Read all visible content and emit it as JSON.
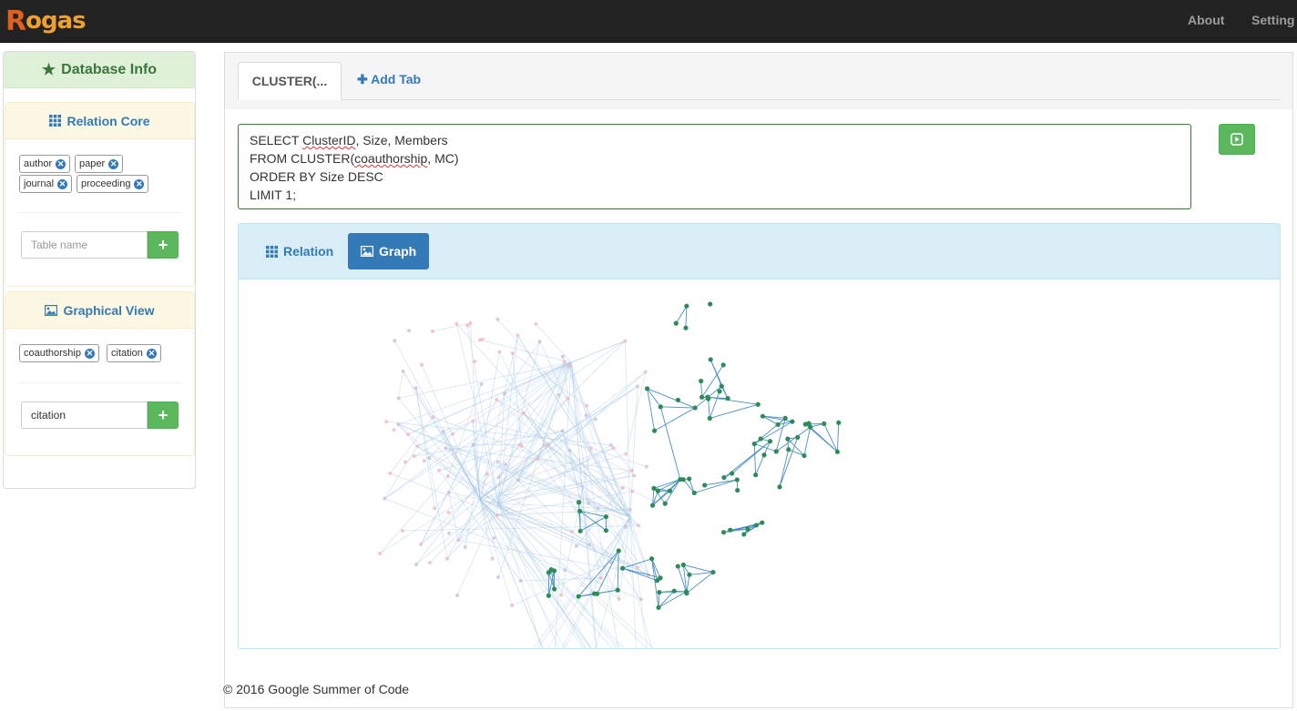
{
  "navbar": {
    "logo_text": "Rogas",
    "links": [
      "About",
      "Setting"
    ]
  },
  "sidebar": {
    "title": "Database Info",
    "relation_core": {
      "title": "Relation Core",
      "tags": [
        "author",
        "paper",
        "journal",
        "proceeding"
      ],
      "input_placeholder": "Table name"
    },
    "graphical_view": {
      "title": "Graphical View",
      "tags": [
        "coauthorship",
        "citation"
      ],
      "input_value": "citation"
    }
  },
  "tabs": {
    "active": "CLUSTER(...",
    "add_label": "Add Tab"
  },
  "query": {
    "lines": [
      "SELECT ClusterID, Size, Members",
      "FROM CLUSTER(coauthorship, MC)",
      "ORDER BY Size DESC",
      "LIMIT 1;"
    ]
  },
  "result": {
    "tabs": [
      "Relation",
      "Graph"
    ],
    "active_tab": "Graph"
  },
  "graph": {
    "highlight_color": "#2e8b57",
    "edge_color": "#4a90c2",
    "faded_edge_color": "#a9c9e6",
    "faded_node_color": "#f0b8c8"
  },
  "footer": {
    "text": "© 2016 Google Summer of Code"
  },
  "colors": {
    "navbar": "#222222",
    "primary": "#337ab7",
    "success": "#5cb85c",
    "success_head": "#dff0d8",
    "warning_head": "#fcf8e3",
    "info_head": "#d9edf7"
  }
}
